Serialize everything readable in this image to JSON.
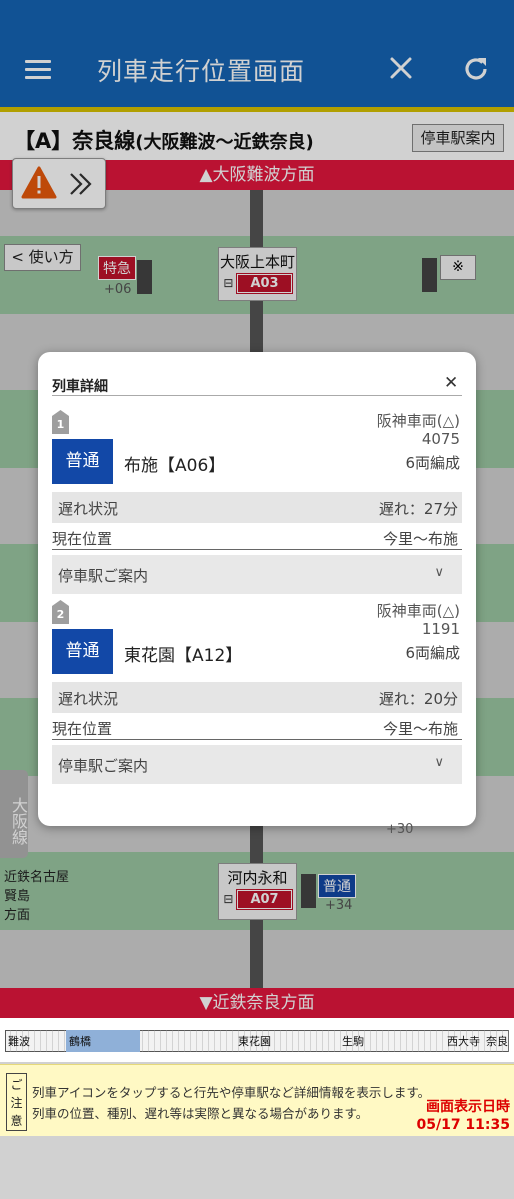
{
  "header": {
    "title": "列車走行位置画面"
  },
  "line": {
    "code": "【A】",
    "name": "奈良線",
    "range": "(大阪難波〜近鉄奈良)",
    "stop_info_button": "停車駅案内"
  },
  "directions": {
    "up": "▲大阪難波方面",
    "down": "▼近鉄奈良方面"
  },
  "map": {
    "howto": "< 使い方",
    "note_mark": "※",
    "stations": [
      {
        "name": "大阪上本町",
        "code": "A03"
      },
      {
        "name": "河内永和",
        "code": "A07"
      }
    ],
    "trains": [
      {
        "type": "特急",
        "delay": "+06"
      },
      {
        "type": "普通",
        "delay": "+34"
      },
      {
        "delay": "+30"
      }
    ],
    "side_tab": "大阪線",
    "side_note": [
      "近鉄名古屋",
      "賢島",
      "方面"
    ]
  },
  "dialog": {
    "title": "列車詳細",
    "trains": [
      {
        "no": "1",
        "owner": "阪神車両(△)",
        "car_no": "4075",
        "type": "普通",
        "destination": "布施【A06】",
        "cars": "6両編成",
        "delay_label": "遅れ状況",
        "delay_value": "遅れ：27分",
        "pos_label": "現在位置",
        "pos_value": "今里〜布施",
        "stops_label": "停車駅ご案内"
      },
      {
        "no": "2",
        "owner": "阪神車両(△)",
        "car_no": "1191",
        "type": "普通",
        "destination": "東花園【A12】",
        "cars": "6両編成",
        "delay_label": "遅れ状況",
        "delay_value": "遅れ：20分",
        "pos_label": "現在位置",
        "pos_value": "今里〜布施",
        "stops_label": "停車駅ご案内"
      }
    ]
  },
  "strip": {
    "stations": [
      "難波",
      "鶴橋",
      "東花園",
      "生駒",
      "西大寺",
      "奈良"
    ]
  },
  "caution": {
    "label": "ご注意",
    "line1": "列車アイコンをタップすると行先や停車駅など詳細情報を表示します。",
    "line2": "列車の位置、種別、遅れ等は実際と異なる場合があります。",
    "datetime_label": "画面表示日時",
    "datetime": "05/17 11:35"
  },
  "colors": {
    "header": "#1565b5",
    "direction_bar": "#e3173e",
    "local_train": "#1248a7",
    "station_code": "#c0132b"
  }
}
